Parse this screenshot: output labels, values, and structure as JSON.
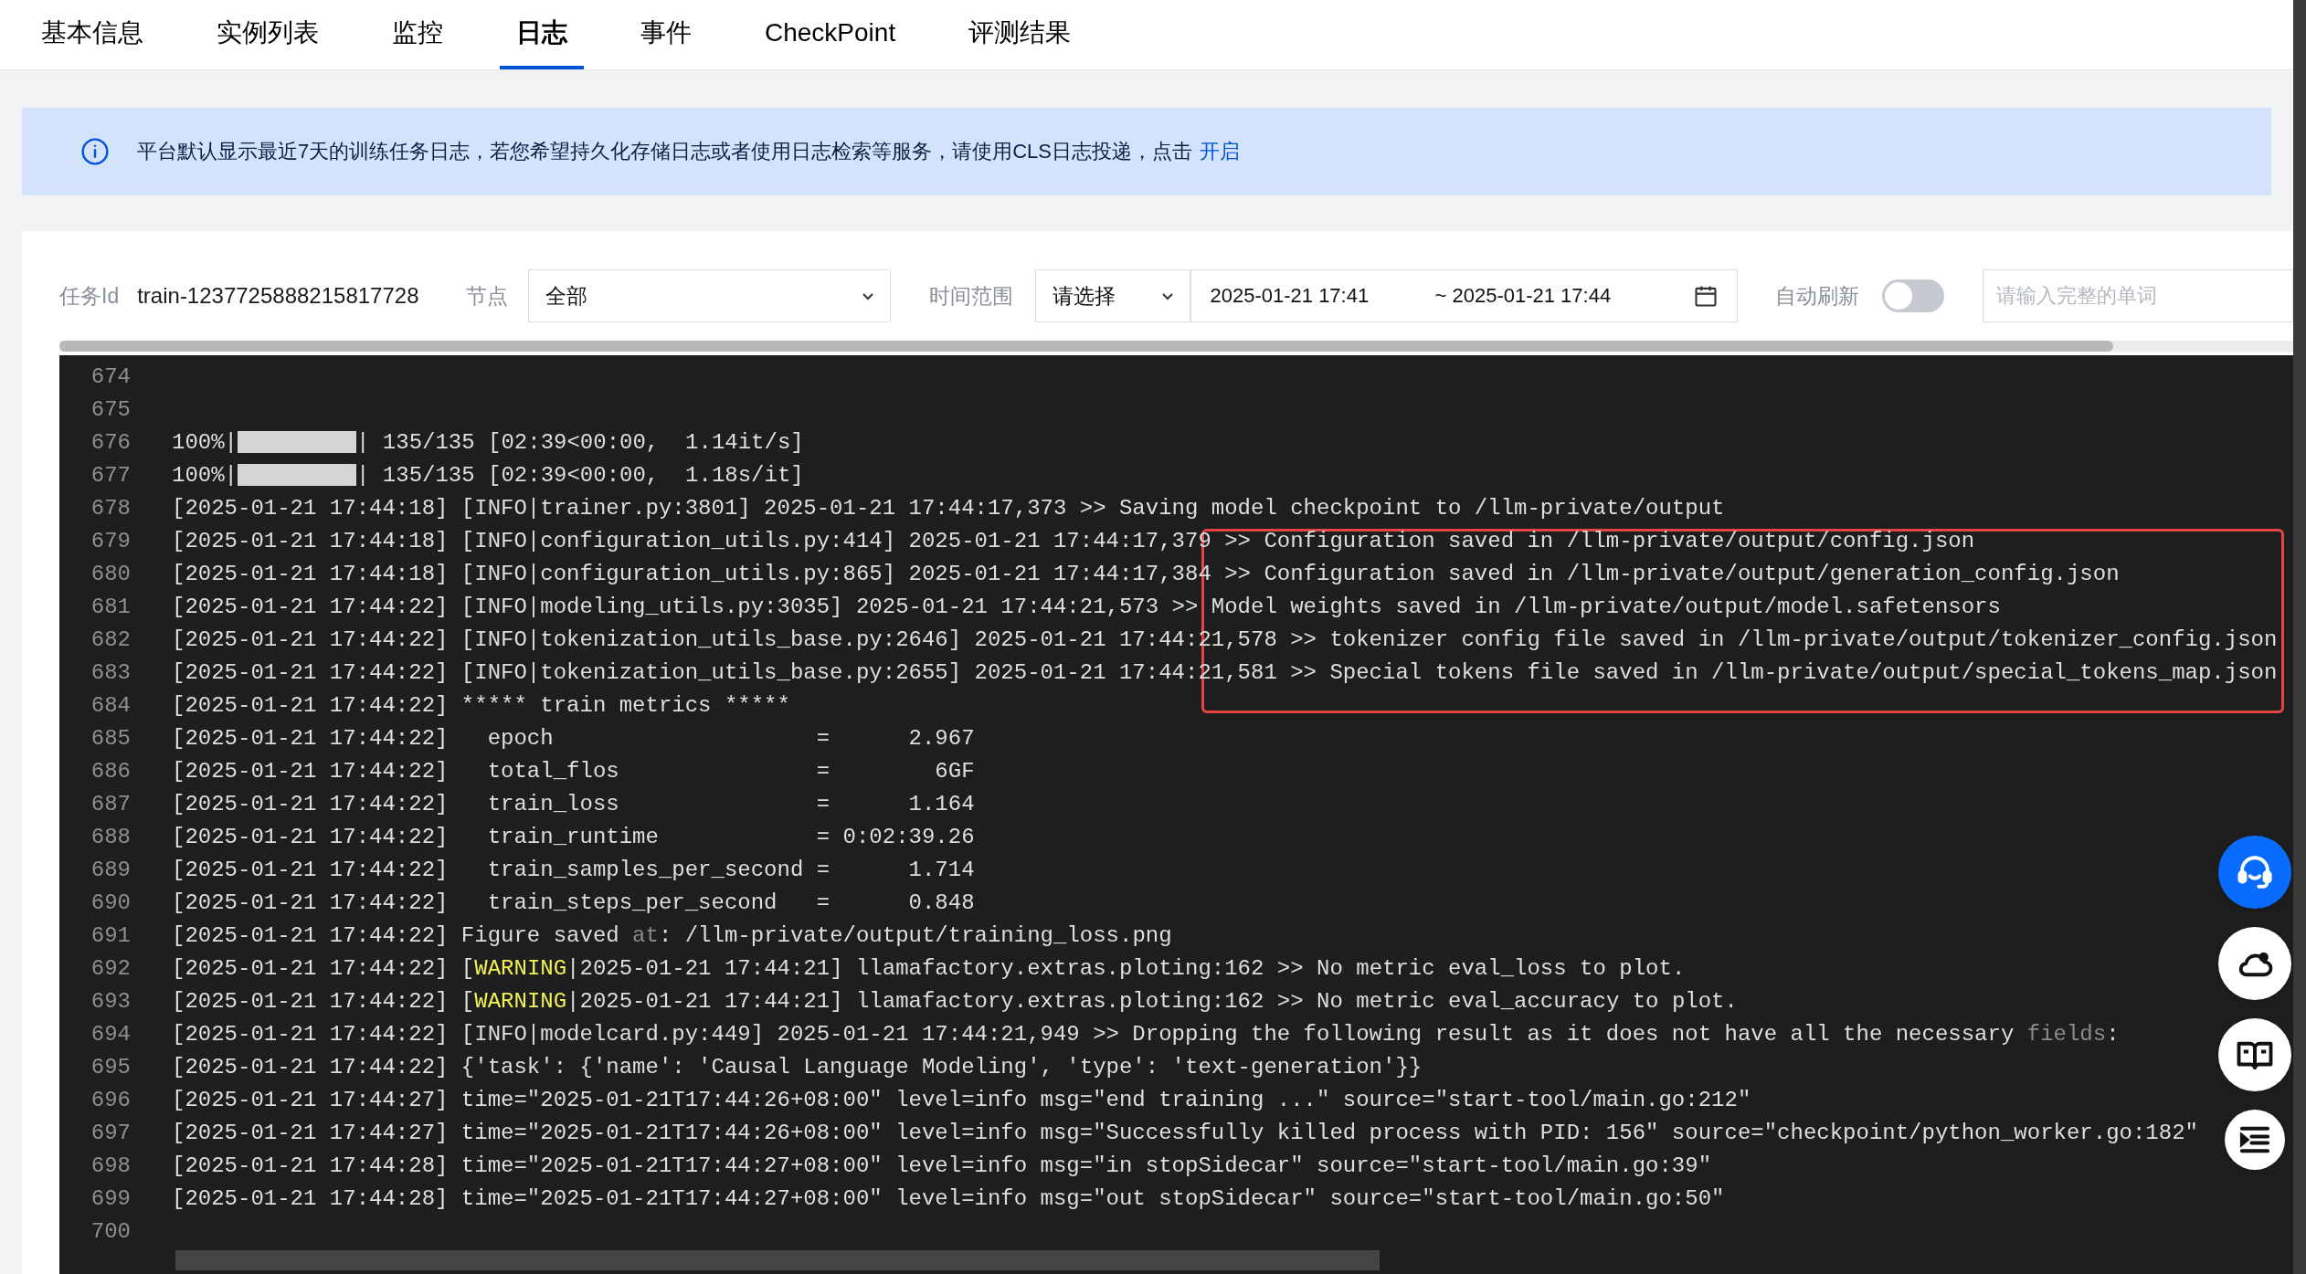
{
  "tabs": [
    {
      "label": "基本信息",
      "selected": false
    },
    {
      "label": "实例列表",
      "selected": false
    },
    {
      "label": "监控",
      "selected": false
    },
    {
      "label": "日志",
      "selected": true
    },
    {
      "label": "事件",
      "selected": false
    },
    {
      "label": "CheckPoint",
      "selected": false
    },
    {
      "label": "评测结果",
      "selected": false
    }
  ],
  "notice": {
    "text": "平台默认显示最近7天的训练任务日志，若您希望持久化存储日志或者使用日志检索等服务，请使用CLS日志投递，点击",
    "link": "开启"
  },
  "filters": {
    "task_id_label": "任务Id",
    "task_id": "train-1237725888215817728",
    "node_label": "节点",
    "node_value": "全部",
    "time_label": "时间范围",
    "time_preset": "请选择",
    "start": "2025-01-21 17:41",
    "end": "~ 2025-01-21 17:44",
    "auto_refresh_label": "自动刷新",
    "auto_refresh_on": false,
    "search_placeholder": "请输入完整的单词"
  },
  "log_lines": [
    {
      "number": "674"
    },
    {
      "number": "675"
    },
    {
      "number": "676",
      "kind": "progress",
      "prefix": "100%|",
      "level": 1,
      "suffix": "| 135/135 [02:39<00:00,  1.14it/s]"
    },
    {
      "number": "677",
      "kind": "progress",
      "prefix": "100%|",
      "level": 1,
      "suffix": "| 135/135 [02:39<00:00,  1.18s/it]"
    },
    {
      "number": "678",
      "text": "[2025-01-21 17:44:18] [INFO|trainer.py:3801] 2025-01-21 17:44:17,373 >> Saving model checkpoint to /llm-private/output"
    },
    {
      "number": "679",
      "text": "[2025-01-21 17:44:18] [INFO|configuration_utils.py:414] 2025-01-21 17:44:17,379 >> Configuration saved in /llm-private/output/config.json"
    },
    {
      "number": "680",
      "text": "[2025-01-21 17:44:18] [INFO|configuration_utils.py:865] 2025-01-21 17:44:17,384 >> Configuration saved in /llm-private/output/generation_config.json"
    },
    {
      "number": "681",
      "text": "[2025-01-21 17:44:22] [INFO|modeling_utils.py:3035] 2025-01-21 17:44:21,573 >> Model weights saved in /llm-private/output/model.safetensors"
    },
    {
      "number": "682",
      "text": "[2025-01-21 17:44:22] [INFO|tokenization_utils_base.py:2646] 2025-01-21 17:44:21,578 >> tokenizer config file saved in /llm-private/output/tokenizer_config.json"
    },
    {
      "number": "683",
      "text": "[2025-01-21 17:44:22] [INFO|tokenization_utils_base.py:2655] 2025-01-21 17:44:21,581 >> Special tokens file saved in /llm-private/output/special_tokens_map.json"
    },
    {
      "number": "684",
      "text": "[2025-01-21 17:44:22] ***** train metrics *****"
    },
    {
      "number": "685",
      "text": "[2025-01-21 17:44:22]   epoch                    =      2.967"
    },
    {
      "number": "686",
      "text": "[2025-01-21 17:44:22]   total_flos               =        6GF"
    },
    {
      "number": "687",
      "text": "[2025-01-21 17:44:22]   train_loss               =      1.164"
    },
    {
      "number": "688",
      "text": "[2025-01-21 17:44:22]   train_runtime            = 0:02:39.26"
    },
    {
      "number": "689",
      "text": "[2025-01-21 17:44:22]   train_samples_per_second =      1.714"
    },
    {
      "number": "690",
      "text": "[2025-01-21 17:44:22]   train_steps_per_second   =      0.848"
    },
    {
      "number": "691",
      "segments": [
        {
          "text": "[2025-01-21 17:44:22] Figure saved ",
          "kind": "plain"
        },
        {
          "text": "at",
          "kind": "dim"
        },
        {
          "text": ": /llm-private/output/training_loss.png",
          "kind": "plain"
        }
      ]
    },
    {
      "number": "692",
      "segments": [
        {
          "text": "[2025-01-21 17:44:22] [",
          "kind": "plain"
        },
        {
          "text": "WARNING",
          "kind": "warning"
        },
        {
          "text": "|2025-01-21 17:44:21] llamafactory.extras.ploting:162 >> No metric eval_loss to plot.",
          "kind": "plain"
        }
      ]
    },
    {
      "number": "693",
      "segments": [
        {
          "text": "[2025-01-21 17:44:22] [",
          "kind": "plain"
        },
        {
          "text": "WARNING",
          "kind": "warning"
        },
        {
          "text": "|2025-01-21 17:44:21] llamafactory.extras.ploting:162 >> No metric eval_accuracy to plot.",
          "kind": "plain"
        }
      ]
    },
    {
      "number": "694",
      "segments": [
        {
          "text": "[2025-01-21 17:44:22] [INFO|modelcard.py:449] 2025-01-21 17:44:21,949 >> Dropping the following result as it does not have all the necessary ",
          "kind": "plain"
        },
        {
          "text": "fields",
          "kind": "dim"
        },
        {
          "text": ":",
          "kind": "plain"
        }
      ]
    },
    {
      "number": "695",
      "text": "[2025-01-21 17:44:22] {'task': {'name': 'Causal Language Modeling', 'type': 'text-generation'}}"
    },
    {
      "number": "696",
      "text": "[2025-01-21 17:44:27] time=\"2025-01-21T17:44:26+08:00\" level=info msg=\"end training ...\" source=\"start-tool/main.go:212\""
    },
    {
      "number": "697",
      "text": "[2025-01-21 17:44:27] time=\"2025-01-21T17:44:26+08:00\" level=info msg=\"Successfully killed process with PID: 156\" source=\"checkpoint/python_worker.go:182\""
    },
    {
      "number": "698",
      "text": "[2025-01-21 17:44:28] time=\"2025-01-21T17:44:27+08:00\" level=info msg=\"in stopSidecar\" source=\"start-tool/main.go:39\""
    },
    {
      "number": "699",
      "text": "[2025-01-21 17:44:28] time=\"2025-01-21T17:44:27+08:00\" level=info msg=\"out stopSidecar\" source=\"start-tool/main.go:50\""
    },
    {
      "number": "700"
    }
  ],
  "floating_buttons": [
    {
      "kind": "support",
      "active": true
    },
    {
      "kind": "cloud",
      "active": false
    },
    {
      "kind": "book",
      "active": false
    },
    {
      "kind": "list",
      "active": false
    }
  ]
}
